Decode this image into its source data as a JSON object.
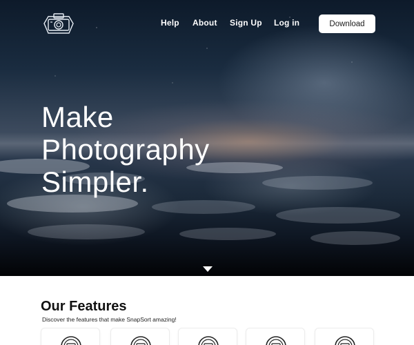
{
  "nav": {
    "logo_icon": "camera-logo-icon",
    "links": [
      {
        "label": "Help"
      },
      {
        "label": "About"
      },
      {
        "label": "Sign Up"
      },
      {
        "label": "Log in"
      }
    ],
    "download_label": "Download"
  },
  "hero": {
    "headline_lines": [
      "Make",
      "Photography",
      "Simpler."
    ],
    "scroll_icon": "caret-down-icon"
  },
  "features": {
    "title": "Our Features",
    "subtitle": "Discover the features that make SnapSort amazing!",
    "cards": [
      {
        "icon": "feature-camera-icon"
      },
      {
        "icon": "feature-camera-icon"
      },
      {
        "icon": "feature-camera-icon"
      },
      {
        "icon": "feature-camera-icon"
      },
      {
        "icon": "feature-camera-icon"
      }
    ]
  },
  "colors": {
    "hero_dark": "#0d1a2a",
    "sunset_glow": "#c49678",
    "button_bg": "#ffffff",
    "text_light": "#ffffff",
    "text_dark": "#111111"
  }
}
